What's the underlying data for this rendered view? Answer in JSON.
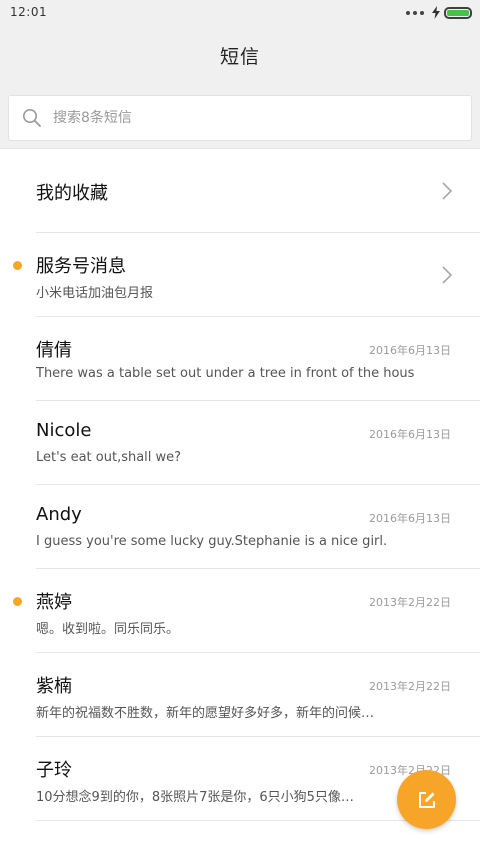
{
  "status_bar": {
    "time": "12:01",
    "battery_level": 1.0,
    "battery_color": "#46c24b"
  },
  "header": {
    "title": "短信"
  },
  "search": {
    "placeholder": "搜索8条短信"
  },
  "conversations": [
    {
      "name": "我的收藏",
      "preview": "",
      "date": "",
      "unread": false,
      "has_chevron": true
    },
    {
      "name": "服务号消息",
      "preview": "小米电话加油包月报",
      "date": "",
      "unread": true,
      "has_chevron": true
    },
    {
      "name": "倩倩",
      "preview": "There was a table set out under a tree in front of the hous",
      "date": "2016年6月13日",
      "unread": false,
      "has_chevron": false
    },
    {
      "name": "Nicole",
      "preview": "Let's eat out,shall we?",
      "date": "2016年6月13日",
      "unread": false,
      "has_chevron": false
    },
    {
      "name": "Andy",
      "preview": "I guess you're some lucky guy.Stephanie is a nice girl.",
      "date": "2016年6月13日",
      "unread": false,
      "has_chevron": false
    },
    {
      "name": "燕婷",
      "preview": "嗯。收到啦。同乐同乐。",
      "date": "2013年2月22日",
      "unread": true,
      "has_chevron": false
    },
    {
      "name": "紫楠",
      "preview": "新年的祝福数不胜数，新年的愿望好多好多，新年的问候…",
      "date": "2013年2月22日",
      "unread": false,
      "has_chevron": false
    },
    {
      "name": "子玲",
      "preview": "10分想念9到的你，8张照片7张是你，6只小狗5只像…",
      "date": "2013年2月22日",
      "unread": false,
      "has_chevron": false
    }
  ],
  "colors": {
    "accent": "#f5a623",
    "unread_dot": "#f5a623",
    "background": "#ffffff",
    "header_bg": "#f0f0f0"
  },
  "icons": {
    "search": "search-icon",
    "chevron": "chevron-right-icon",
    "compose": "compose-icon"
  }
}
